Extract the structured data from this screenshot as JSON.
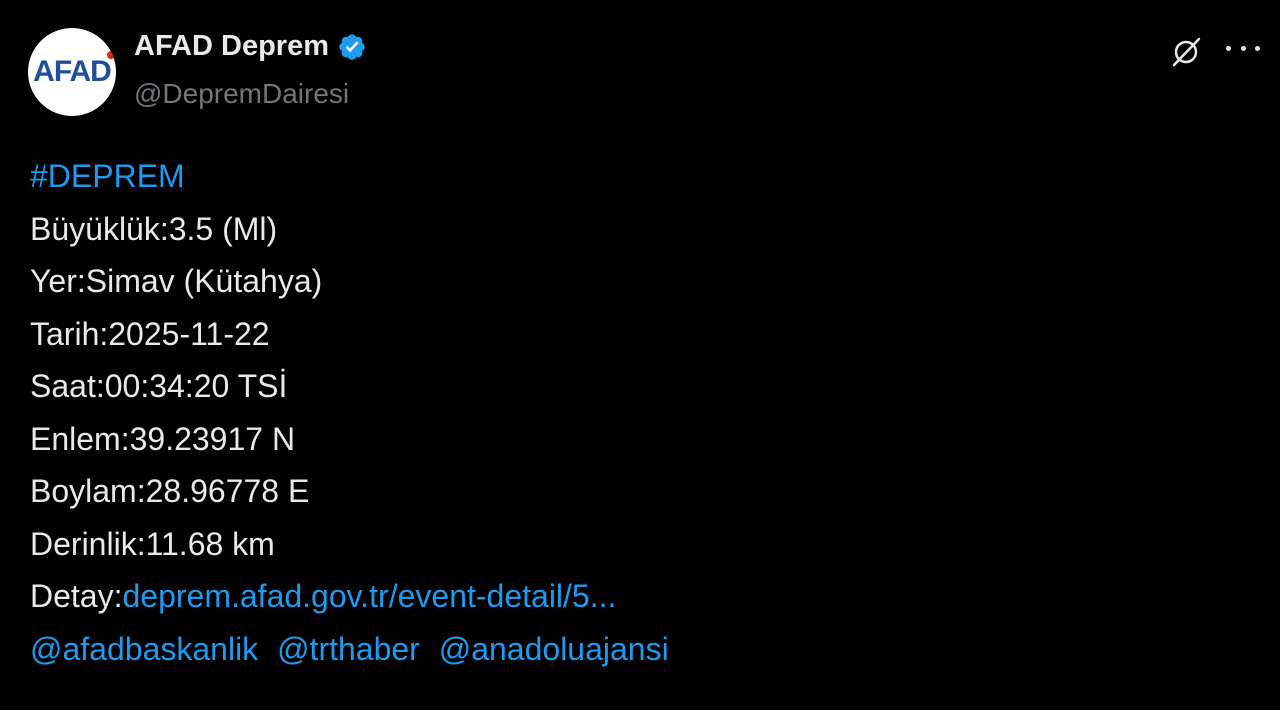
{
  "author": {
    "avatar_text": "AFAD",
    "display_name": "AFAD Deprem",
    "handle": "@DepremDairesi",
    "verified": true
  },
  "tweet": {
    "hashtag": "#DEPREM",
    "lines": [
      "Büyüklük:3.5 (Ml)",
      "Yer:Simav (Kütahya)",
      "Tarih:2025-11-22",
      "Saat:00:34:20 TSİ",
      "Enlem:39.23917 N",
      "Boylam:28.96778 E",
      "Derinlik:11.68 km"
    ],
    "detail_label": "Detay:",
    "detail_link": "deprem.afad.gov.tr/event-detail/5...",
    "mentions": [
      "@afadbaskanlik",
      "@trthaber",
      "@anadoluajansi"
    ]
  },
  "icons": {
    "verified": "verified-badge-icon",
    "grok": "grok-icon",
    "more": "more-icon"
  },
  "colors": {
    "background": "#000000",
    "text": "#e7e9ea",
    "secondary_text": "#71767b",
    "link": "#1d9bf0",
    "verified": "#1d9bf0",
    "afad_blue": "#1f4e9c",
    "afad_red": "#e2231a"
  }
}
